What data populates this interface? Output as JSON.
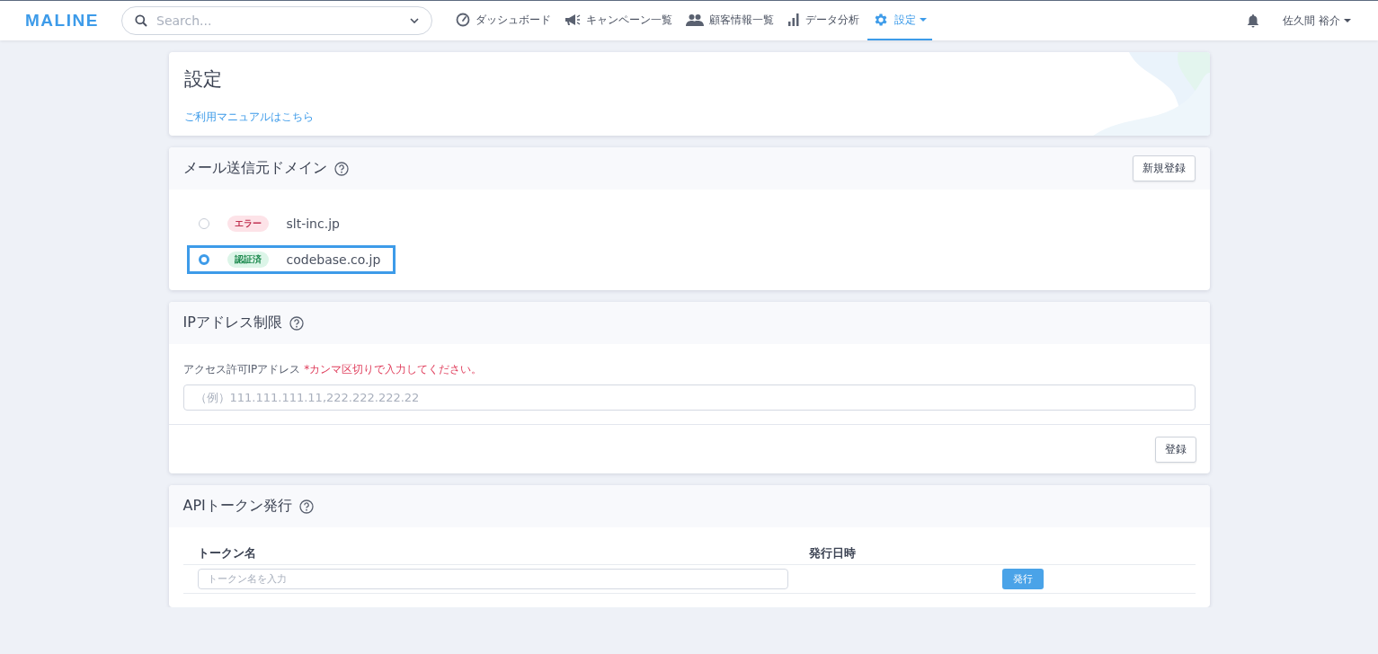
{
  "navbar": {
    "logo": "MALINE",
    "search": {
      "placeholder": "Search..."
    },
    "nav_items": [
      {
        "label": "ダッシュボード",
        "kind": "gauge",
        "selected": false,
        "dropdown": false
      },
      {
        "label": "キャンペーン一覧",
        "kind": "megaphone",
        "selected": false,
        "dropdown": false
      },
      {
        "label": "顧客情報一覧",
        "kind": "people",
        "selected": false,
        "dropdown": false
      },
      {
        "label": "データ分析",
        "kind": "bars",
        "selected": false,
        "dropdown": false
      },
      {
        "label": "設定",
        "kind": "gear",
        "selected": true,
        "dropdown": true
      }
    ],
    "user": "佐久間 裕介"
  },
  "header": {
    "title": "設定",
    "manual_link": "ご利用マニュアルはこちら"
  },
  "domain_section": {
    "title": "メール送信元ドメイン",
    "new_button": "新規登録",
    "domains": [
      {
        "status": "エラー",
        "kind": "error",
        "name": "slt-inc.jp",
        "selected": false
      },
      {
        "status": "認証済",
        "kind": "verified",
        "name": "codebase.co.jp",
        "selected": true
      }
    ]
  },
  "ip_section": {
    "title": "IPアドレス制限",
    "label": "アクセス許可IPアドレス",
    "note": "*カンマ区切りで入力してください。",
    "placeholder": "（例）111.111.111.11,222.222.222.22",
    "button": "登録"
  },
  "token_section": {
    "title": "APIトークン発行",
    "columns": [
      "トークン名",
      "発行日時"
    ],
    "placeholder": "トークン名を入力",
    "button": "発行"
  }
}
